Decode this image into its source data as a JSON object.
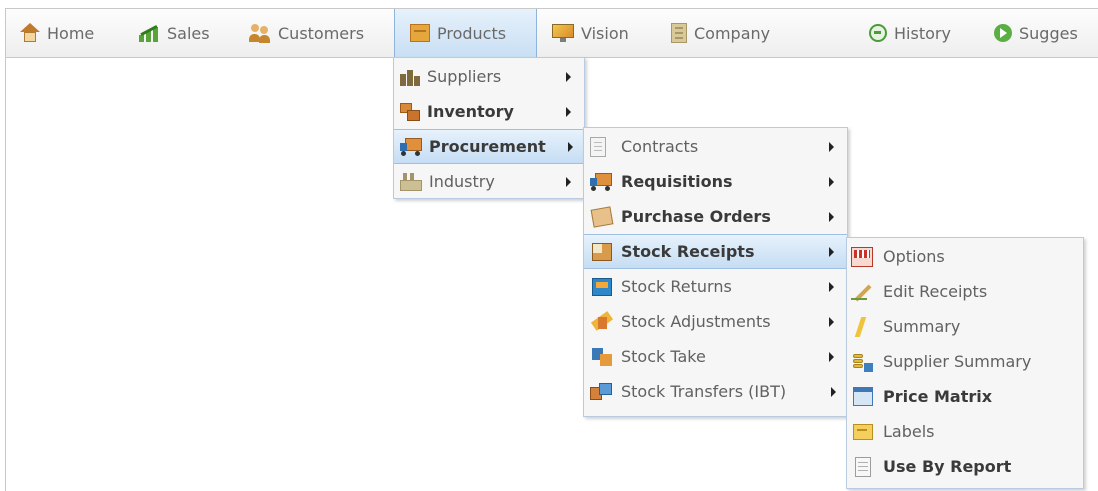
{
  "navbar": {
    "items": [
      {
        "label": "Home",
        "icon": "home-icon"
      },
      {
        "label": "Sales",
        "icon": "sales-chart-icon"
      },
      {
        "label": "Customers",
        "icon": "customers-icon"
      },
      {
        "label": "Products",
        "icon": "products-box-icon",
        "active": true
      },
      {
        "label": "Vision",
        "icon": "vision-monitor-icon"
      },
      {
        "label": "Company",
        "icon": "company-building-icon"
      },
      {
        "label": "History",
        "icon": "history-icon"
      },
      {
        "label": "Sugges",
        "icon": "suggest-icon"
      }
    ]
  },
  "products_menu": {
    "items": [
      {
        "label": "Suppliers",
        "bold": false,
        "has_submenu": true
      },
      {
        "label": "Inventory",
        "bold": true,
        "has_submenu": true
      },
      {
        "label": "Procurement",
        "bold": true,
        "has_submenu": true,
        "active": true
      },
      {
        "label": "Industry",
        "bold": false,
        "has_submenu": true
      }
    ]
  },
  "procurement_menu": {
    "items": [
      {
        "label": "Contracts",
        "bold": false,
        "has_submenu": true
      },
      {
        "label": "Requisitions",
        "bold": true,
        "has_submenu": true
      },
      {
        "label": "Purchase Orders",
        "bold": true,
        "has_submenu": true
      },
      {
        "label": "Stock Receipts",
        "bold": true,
        "has_submenu": true,
        "active": true
      },
      {
        "label": "Stock Returns",
        "bold": false,
        "has_submenu": true
      },
      {
        "label": "Stock Adjustments",
        "bold": false,
        "has_submenu": true
      },
      {
        "label": "Stock Take",
        "bold": false,
        "has_submenu": true
      },
      {
        "label": "Stock Transfers (IBT)",
        "bold": false,
        "has_submenu": true
      }
    ]
  },
  "stock_receipts_menu": {
    "items": [
      {
        "label": "Options",
        "bold": false
      },
      {
        "label": "Edit Receipts",
        "bold": false
      },
      {
        "label": "Summary",
        "bold": false
      },
      {
        "label": "Supplier Summary",
        "bold": false
      },
      {
        "label": "Price Matrix",
        "bold": true
      },
      {
        "label": "Labels",
        "bold": false
      },
      {
        "label": "Use By Report",
        "bold": true
      }
    ]
  },
  "colors": {
    "menu_highlight": "#c6ddf3",
    "menu_border": "#b9cbe0",
    "text": "#616161"
  }
}
